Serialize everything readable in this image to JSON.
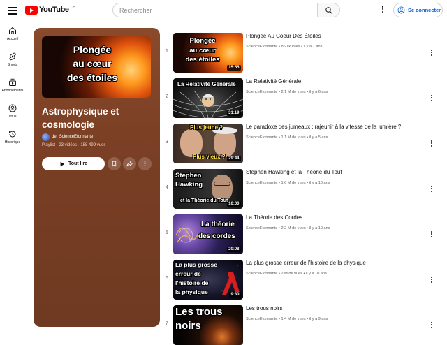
{
  "app": {
    "logo_text": "YouTube",
    "country": "CH"
  },
  "search": {
    "placeholder": "Rechercher"
  },
  "header": {
    "signin_label": "Se connecter"
  },
  "guide": {
    "items": [
      {
        "label": "Accueil",
        "icon": "home-icon"
      },
      {
        "label": "Shorts",
        "icon": "shorts-icon"
      },
      {
        "label": "Abonnements",
        "icon": "subscriptions-icon"
      },
      {
        "label": "Vous",
        "icon": "you-icon"
      },
      {
        "label": "Historique",
        "icon": "history-icon"
      }
    ]
  },
  "playlist": {
    "thumb_text": [
      "Plongée",
      "au cœur",
      "des étoiles"
    ],
    "title": "Astrophysique et cosmologie",
    "owner_prefix": "de",
    "owner": "ScienceEtonnante",
    "meta": "Playlist · 23 vidéos · 158 499 vues",
    "play_all_label": "Tout lire"
  },
  "colors": {
    "accent_blue": "#065fd4",
    "youtube_red": "#ff0000",
    "panel_brown": "#7a3f24"
  },
  "videos": [
    {
      "index": "1",
      "title": "Plongée Au Coeur Des Étoiles",
      "channel": "ScienceEtonnante",
      "views": "860 k vues",
      "age": "il y a 7 ans",
      "duration": "15:55",
      "thumb_text": [
        "Plongée",
        "au cœur",
        "des étoiles"
      ]
    },
    {
      "index": "2",
      "title": "La Relativité Générale",
      "channel": "ScienceEtonnante",
      "views": "2,1 M de vues",
      "age": "il y a 6 ans",
      "duration": "31:19",
      "thumb_text": [
        "La Relativité Générale"
      ]
    },
    {
      "index": "3",
      "title": "Le paradoxe des jumeaux : rajeunir à la vitesse de la lumière ?",
      "channel": "ScienceEtonnante",
      "views": "1,1 M de vues",
      "age": "il y a 5 ans",
      "duration": "29:44",
      "thumb_text": [
        "Plus jeune ?",
        "Plus vieux ?"
      ]
    },
    {
      "index": "4",
      "title": "Stephen Hawking et la Théorie du Tout",
      "channel": "ScienceEtonnante",
      "views": "1,6 M de vues",
      "age": "il y a 10 ans",
      "duration": "10:00",
      "thumb_text": [
        "Stephen",
        "Hawking",
        "et la Théorie du Tout"
      ]
    },
    {
      "index": "5",
      "title": "La Théorie des Cordes",
      "channel": "ScienceEtonnante",
      "views": "2,2 M de vues",
      "age": "il y a 10 ans",
      "duration": "20:08",
      "thumb_text": [
        "La théorie",
        "des cordes"
      ]
    },
    {
      "index": "6",
      "title": "La plus grosse erreur de l'histoire de la physique",
      "channel": "ScienceEtonnante",
      "views": "2 M de vues",
      "age": "il y a 10 ans",
      "duration": "9:30",
      "thumb_text": [
        "La plus grosse",
        "erreur de",
        "l'histoire de",
        "la physique"
      ]
    },
    {
      "index": "7",
      "title": "Les trous noirs",
      "channel": "ScienceEtonnante",
      "views": "1,4 M de vues",
      "age": "il y a 9 ans",
      "duration": "",
      "thumb_text": [
        "Les trous",
        "noirs"
      ]
    }
  ]
}
